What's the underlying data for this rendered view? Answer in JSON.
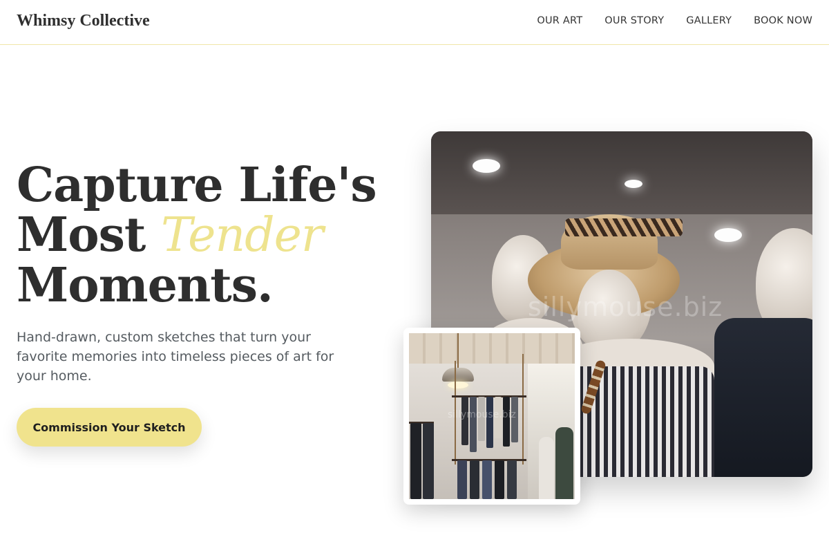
{
  "header": {
    "logo": "Whimsy Collective",
    "nav": [
      "OUR ART",
      "OUR STORY",
      "GALLERY",
      "BOOK NOW"
    ]
  },
  "hero": {
    "title_line1": "Capture Life's",
    "title_line2_pre": "Most ",
    "title_line2_accent": "Tender",
    "title_line3": "Moments.",
    "subtitle": "Hand-drawn, custom sketches that turn your favorite memories into timeless pieces of art for your home.",
    "cta_label": "Commission Your Sketch"
  },
  "images": {
    "main_watermark": "sillymouse.biz",
    "inset_watermark": "sillymouse.biz"
  },
  "colors": {
    "accent": "#eee38e",
    "cta_bg": "#f0e38d",
    "text": "#2e2e2e",
    "header_border": "#f0e6a8"
  }
}
